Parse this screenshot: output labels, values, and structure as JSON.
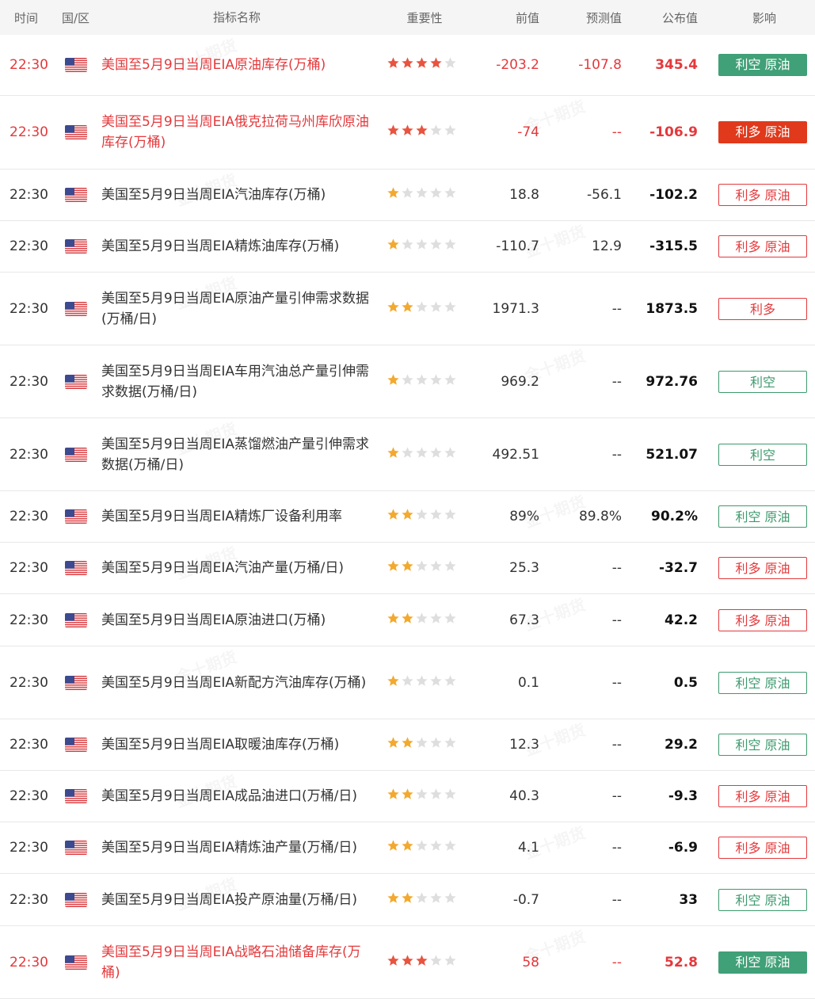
{
  "header": {
    "time": "时间",
    "country": "国/区",
    "name": "指标名称",
    "importance": "重要性",
    "previous": "前值",
    "forecast": "预测值",
    "actual": "公布值",
    "impact": "影响"
  },
  "watermark": "金十期货",
  "colors": {
    "highlight_red": "#e4393c",
    "green": "#3d9a6e",
    "green_solid_bg": "#40a077",
    "red_solid_bg": "#e0391b",
    "red_outline": "#e4393c",
    "green_outline": "#3d9a6e",
    "star_gold": "#f3a92f",
    "star_red": "#e8543f",
    "star_empty": "#dedede"
  },
  "rows": [
    {
      "time": "22:30",
      "flag": "us-flag",
      "name": "美国至5月9日当周EIA原油库存(万桶)",
      "stars": 4,
      "previous": "-203.2",
      "forecast": "-107.8",
      "actual": "345.4",
      "impact": "利空 原油",
      "impact_style": "green-solid",
      "highlight": true,
      "h": 76
    },
    {
      "time": "22:30",
      "flag": "us-flag",
      "name": "美国至5月9日当周EIA俄克拉荷马州库欣原油库存(万桶)",
      "stars": 3,
      "previous": "-74",
      "forecast": "--",
      "actual": "-106.9",
      "impact": "利多 原油",
      "impact_style": "red-solid",
      "highlight": true,
      "h": 92
    },
    {
      "time": "22:30",
      "flag": "us-flag",
      "name": "美国至5月9日当周EIA汽油库存(万桶)",
      "stars": 1,
      "previous": "18.8",
      "forecast": "-56.1",
      "actual": "-102.2",
      "impact": "利多 原油",
      "impact_style": "red-outline",
      "highlight": false,
      "h": 64
    },
    {
      "time": "22:30",
      "flag": "us-flag",
      "name": "美国至5月9日当周EIA精炼油库存(万桶)",
      "stars": 1,
      "previous": "-110.7",
      "forecast": "12.9",
      "actual": "-315.5",
      "impact": "利多 原油",
      "impact_style": "red-outline",
      "highlight": false,
      "h": 64
    },
    {
      "time": "22:30",
      "flag": "us-flag",
      "name": "美国至5月9日当周EIA原油产量引伸需求数据(万桶/日)",
      "stars": 2,
      "previous": "1971.3",
      "forecast": "--",
      "actual": "1873.5",
      "impact": "利多",
      "impact_style": "red-outline",
      "highlight": false,
      "h": 91
    },
    {
      "time": "22:30",
      "flag": "us-flag",
      "name": "美国至5月9日当周EIA车用汽油总产量引伸需求数据(万桶/日)",
      "stars": 1,
      "previous": "969.2",
      "forecast": "--",
      "actual": "972.76",
      "impact": "利空",
      "impact_style": "green-outline",
      "highlight": false,
      "h": 91
    },
    {
      "time": "22:30",
      "flag": "us-flag",
      "name": "美国至5月9日当周EIA蒸馏燃油产量引伸需求数据(万桶/日)",
      "stars": 1,
      "previous": "492.51",
      "forecast": "--",
      "actual": "521.07",
      "impact": "利空",
      "impact_style": "green-outline",
      "highlight": false,
      "h": 91
    },
    {
      "time": "22:30",
      "flag": "us-flag",
      "name": "美国至5月9日当周EIA精炼厂设备利用率",
      "stars": 2,
      "previous": "89%",
      "forecast": "89.8%",
      "actual": "90.2%",
      "impact": "利空 原油",
      "impact_style": "green-outline",
      "highlight": false,
      "h": 64
    },
    {
      "time": "22:30",
      "flag": "us-flag",
      "name": "美国至5月9日当周EIA汽油产量(万桶/日)",
      "stars": 2,
      "previous": "25.3",
      "forecast": "--",
      "actual": "-32.7",
      "impact": "利多 原油",
      "impact_style": "red-outline",
      "highlight": false,
      "h": 64
    },
    {
      "time": "22:30",
      "flag": "us-flag",
      "name": "美国至5月9日当周EIA原油进口(万桶)",
      "stars": 2,
      "previous": "67.3",
      "forecast": "--",
      "actual": "42.2",
      "impact": "利多 原油",
      "impact_style": "red-outline",
      "highlight": false,
      "h": 65
    },
    {
      "time": "22:30",
      "flag": "us-flag",
      "name": "美国至5月9日当周EIA新配方汽油库存(万桶)",
      "stars": 1,
      "previous": "0.1",
      "forecast": "--",
      "actual": "0.5",
      "impact": "利空 原油",
      "impact_style": "green-outline",
      "highlight": false,
      "h": 91
    },
    {
      "time": "22:30",
      "flag": "us-flag",
      "name": "美国至5月9日当周EIA取暖油库存(万桶)",
      "stars": 2,
      "previous": "12.3",
      "forecast": "--",
      "actual": "29.2",
      "impact": "利空 原油",
      "impact_style": "green-outline",
      "highlight": false,
      "h": 64
    },
    {
      "time": "22:30",
      "flag": "us-flag",
      "name": "美国至5月9日当周EIA成品油进口(万桶/日)",
      "stars": 2,
      "previous": "40.3",
      "forecast": "--",
      "actual": "-9.3",
      "impact": "利多 原油",
      "impact_style": "red-outline",
      "highlight": false,
      "h": 64
    },
    {
      "time": "22:30",
      "flag": "us-flag",
      "name": "美国至5月9日当周EIA精炼油产量(万桶/日)",
      "stars": 2,
      "previous": "4.1",
      "forecast": "--",
      "actual": "-6.9",
      "impact": "利多 原油",
      "impact_style": "red-outline",
      "highlight": false,
      "h": 64
    },
    {
      "time": "22:30",
      "flag": "us-flag",
      "name": "美国至5月9日当周EIA投产原油量(万桶/日)",
      "stars": 2,
      "previous": "-0.7",
      "forecast": "--",
      "actual": "33",
      "impact": "利空 原油",
      "impact_style": "green-outline",
      "highlight": false,
      "h": 65
    },
    {
      "time": "22:30",
      "flag": "us-flag",
      "name": "美国至5月9日当周EIA战略石油储备库存(万桶)",
      "stars": 3,
      "previous": "58",
      "forecast": "--",
      "actual": "52.8",
      "impact": "利空 原油",
      "impact_style": "green-solid",
      "highlight": true,
      "h": 91
    }
  ]
}
